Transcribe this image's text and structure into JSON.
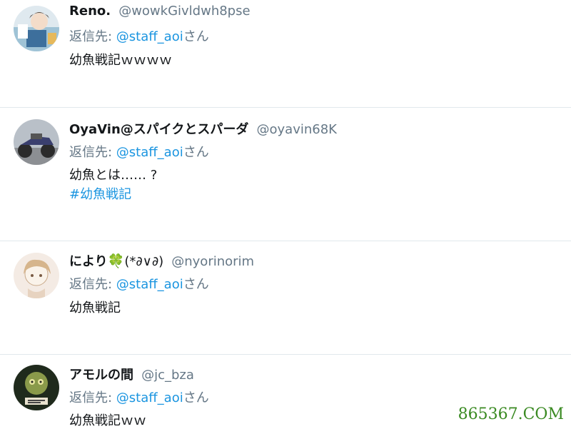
{
  "tweets": [
    {
      "name": "Reno.",
      "handle": "@wowkGivldwh8pse",
      "reply_prefix": "返信先: ",
      "reply_mention": "@staff_aoi",
      "reply_suffix": "さん",
      "text": "幼魚戦記ｗｗｗｗ"
    },
    {
      "name": "OyaVin@スパイクとスパーダ",
      "handle": "@oyavin68K",
      "reply_prefix": "返信先: ",
      "reply_mention": "@staff_aoi",
      "reply_suffix": "さん",
      "text": "幼魚とは…… ?",
      "hashtag": "#幼魚戦記"
    },
    {
      "name": "により",
      "name_emoji": "🍀",
      "name_rest": "(*∂∨∂)",
      "handle": "@nyorinorim",
      "reply_prefix": "返信先: ",
      "reply_mention": "@staff_aoi",
      "reply_suffix": "さん",
      "text": "幼魚戦記"
    },
    {
      "name": "アモルの間",
      "handle": "@jc_bza",
      "reply_prefix": "返信先: ",
      "reply_mention": "@staff_aoi",
      "reply_suffix": "さん",
      "text": "幼魚戦記ｗｗ"
    }
  ],
  "watermark": "865367.COM",
  "colors": {
    "link": "#1b95e0",
    "secondary_text": "#657786",
    "primary_text": "#14171a",
    "divider": "#e1e8ed",
    "watermark": "#3a8a22"
  }
}
